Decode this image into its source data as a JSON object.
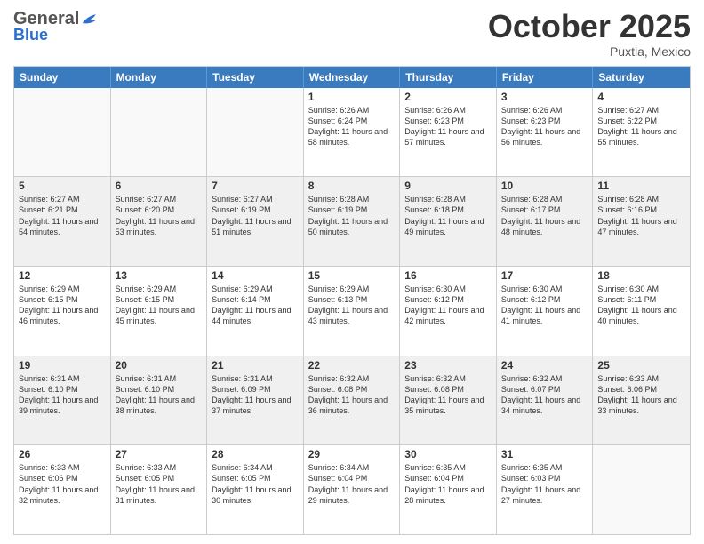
{
  "logo": {
    "general": "General",
    "blue": "Blue",
    "tagline": ""
  },
  "title": "October 2025",
  "subtitle": "Puxtla, Mexico",
  "header_days": [
    "Sunday",
    "Monday",
    "Tuesday",
    "Wednesday",
    "Thursday",
    "Friday",
    "Saturday"
  ],
  "weeks": [
    [
      {
        "day": "",
        "sunrise": "",
        "sunset": "",
        "daylight": "",
        "empty": true
      },
      {
        "day": "",
        "sunrise": "",
        "sunset": "",
        "daylight": "",
        "empty": true
      },
      {
        "day": "",
        "sunrise": "",
        "sunset": "",
        "daylight": "",
        "empty": true
      },
      {
        "day": "1",
        "sunrise": "Sunrise: 6:26 AM",
        "sunset": "Sunset: 6:24 PM",
        "daylight": "Daylight: 11 hours and 58 minutes."
      },
      {
        "day": "2",
        "sunrise": "Sunrise: 6:26 AM",
        "sunset": "Sunset: 6:23 PM",
        "daylight": "Daylight: 11 hours and 57 minutes."
      },
      {
        "day": "3",
        "sunrise": "Sunrise: 6:26 AM",
        "sunset": "Sunset: 6:23 PM",
        "daylight": "Daylight: 11 hours and 56 minutes."
      },
      {
        "day": "4",
        "sunrise": "Sunrise: 6:27 AM",
        "sunset": "Sunset: 6:22 PM",
        "daylight": "Daylight: 11 hours and 55 minutes."
      }
    ],
    [
      {
        "day": "5",
        "sunrise": "Sunrise: 6:27 AM",
        "sunset": "Sunset: 6:21 PM",
        "daylight": "Daylight: 11 hours and 54 minutes."
      },
      {
        "day": "6",
        "sunrise": "Sunrise: 6:27 AM",
        "sunset": "Sunset: 6:20 PM",
        "daylight": "Daylight: 11 hours and 53 minutes."
      },
      {
        "day": "7",
        "sunrise": "Sunrise: 6:27 AM",
        "sunset": "Sunset: 6:19 PM",
        "daylight": "Daylight: 11 hours and 51 minutes."
      },
      {
        "day": "8",
        "sunrise": "Sunrise: 6:28 AM",
        "sunset": "Sunset: 6:19 PM",
        "daylight": "Daylight: 11 hours and 50 minutes."
      },
      {
        "day": "9",
        "sunrise": "Sunrise: 6:28 AM",
        "sunset": "Sunset: 6:18 PM",
        "daylight": "Daylight: 11 hours and 49 minutes."
      },
      {
        "day": "10",
        "sunrise": "Sunrise: 6:28 AM",
        "sunset": "Sunset: 6:17 PM",
        "daylight": "Daylight: 11 hours and 48 minutes."
      },
      {
        "day": "11",
        "sunrise": "Sunrise: 6:28 AM",
        "sunset": "Sunset: 6:16 PM",
        "daylight": "Daylight: 11 hours and 47 minutes."
      }
    ],
    [
      {
        "day": "12",
        "sunrise": "Sunrise: 6:29 AM",
        "sunset": "Sunset: 6:15 PM",
        "daylight": "Daylight: 11 hours and 46 minutes."
      },
      {
        "day": "13",
        "sunrise": "Sunrise: 6:29 AM",
        "sunset": "Sunset: 6:15 PM",
        "daylight": "Daylight: 11 hours and 45 minutes."
      },
      {
        "day": "14",
        "sunrise": "Sunrise: 6:29 AM",
        "sunset": "Sunset: 6:14 PM",
        "daylight": "Daylight: 11 hours and 44 minutes."
      },
      {
        "day": "15",
        "sunrise": "Sunrise: 6:29 AM",
        "sunset": "Sunset: 6:13 PM",
        "daylight": "Daylight: 11 hours and 43 minutes."
      },
      {
        "day": "16",
        "sunrise": "Sunrise: 6:30 AM",
        "sunset": "Sunset: 6:12 PM",
        "daylight": "Daylight: 11 hours and 42 minutes."
      },
      {
        "day": "17",
        "sunrise": "Sunrise: 6:30 AM",
        "sunset": "Sunset: 6:12 PM",
        "daylight": "Daylight: 11 hours and 41 minutes."
      },
      {
        "day": "18",
        "sunrise": "Sunrise: 6:30 AM",
        "sunset": "Sunset: 6:11 PM",
        "daylight": "Daylight: 11 hours and 40 minutes."
      }
    ],
    [
      {
        "day": "19",
        "sunrise": "Sunrise: 6:31 AM",
        "sunset": "Sunset: 6:10 PM",
        "daylight": "Daylight: 11 hours and 39 minutes."
      },
      {
        "day": "20",
        "sunrise": "Sunrise: 6:31 AM",
        "sunset": "Sunset: 6:10 PM",
        "daylight": "Daylight: 11 hours and 38 minutes."
      },
      {
        "day": "21",
        "sunrise": "Sunrise: 6:31 AM",
        "sunset": "Sunset: 6:09 PM",
        "daylight": "Daylight: 11 hours and 37 minutes."
      },
      {
        "day": "22",
        "sunrise": "Sunrise: 6:32 AM",
        "sunset": "Sunset: 6:08 PM",
        "daylight": "Daylight: 11 hours and 36 minutes."
      },
      {
        "day": "23",
        "sunrise": "Sunrise: 6:32 AM",
        "sunset": "Sunset: 6:08 PM",
        "daylight": "Daylight: 11 hours and 35 minutes."
      },
      {
        "day": "24",
        "sunrise": "Sunrise: 6:32 AM",
        "sunset": "Sunset: 6:07 PM",
        "daylight": "Daylight: 11 hours and 34 minutes."
      },
      {
        "day": "25",
        "sunrise": "Sunrise: 6:33 AM",
        "sunset": "Sunset: 6:06 PM",
        "daylight": "Daylight: 11 hours and 33 minutes."
      }
    ],
    [
      {
        "day": "26",
        "sunrise": "Sunrise: 6:33 AM",
        "sunset": "Sunset: 6:06 PM",
        "daylight": "Daylight: 11 hours and 32 minutes."
      },
      {
        "day": "27",
        "sunrise": "Sunrise: 6:33 AM",
        "sunset": "Sunset: 6:05 PM",
        "daylight": "Daylight: 11 hours and 31 minutes."
      },
      {
        "day": "28",
        "sunrise": "Sunrise: 6:34 AM",
        "sunset": "Sunset: 6:05 PM",
        "daylight": "Daylight: 11 hours and 30 minutes."
      },
      {
        "day": "29",
        "sunrise": "Sunrise: 6:34 AM",
        "sunset": "Sunset: 6:04 PM",
        "daylight": "Daylight: 11 hours and 29 minutes."
      },
      {
        "day": "30",
        "sunrise": "Sunrise: 6:35 AM",
        "sunset": "Sunset: 6:04 PM",
        "daylight": "Daylight: 11 hours and 28 minutes."
      },
      {
        "day": "31",
        "sunrise": "Sunrise: 6:35 AM",
        "sunset": "Sunset: 6:03 PM",
        "daylight": "Daylight: 11 hours and 27 minutes."
      },
      {
        "day": "",
        "sunrise": "",
        "sunset": "",
        "daylight": "",
        "empty": true
      }
    ]
  ]
}
